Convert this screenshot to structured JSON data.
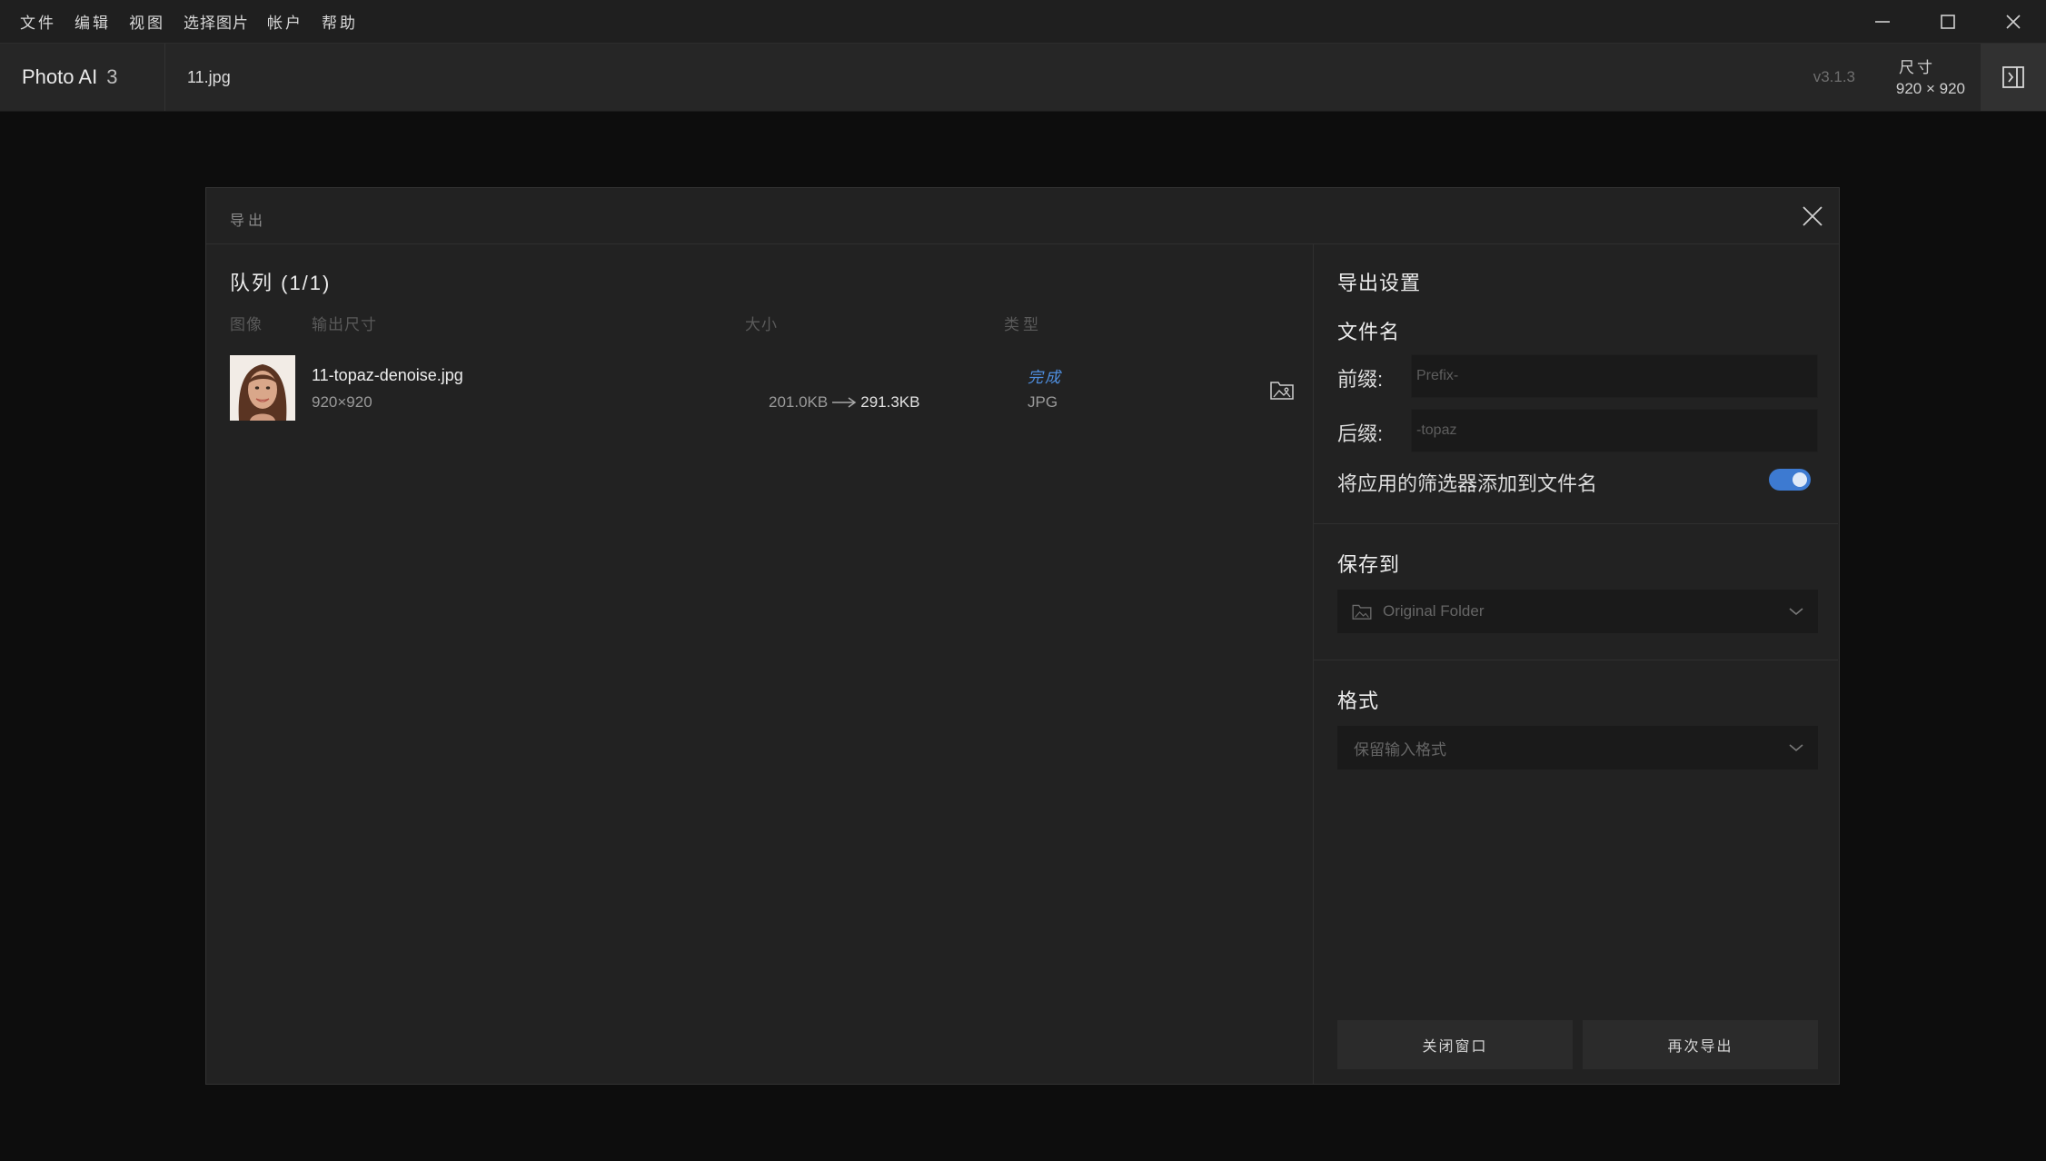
{
  "menubar": {
    "items": [
      "文件",
      "编辑",
      "视图",
      "选择图片",
      "帐户",
      "帮助"
    ]
  },
  "titlebar": {
    "app_name": "Photo AI",
    "app_version_major": "3",
    "file_name": "11.jpg",
    "version": "v3.1.3",
    "dimensions_label": "尺寸",
    "dimensions_value": "920 × 920"
  },
  "dialog": {
    "title": "导出",
    "queue": {
      "title": "队列 (1/1)",
      "columns": {
        "image": "图像",
        "output_size": "输出尺寸",
        "size": "大小",
        "type": "类型"
      },
      "rows": [
        {
          "file_name": "11-topaz-denoise.jpg",
          "dims": "920×920",
          "size_from": "201.0KB",
          "size_to": "291.3KB",
          "status": "完成",
          "type": "JPG"
        }
      ]
    },
    "settings": {
      "title": "导出设置",
      "filename_heading": "文件名",
      "prefix_label": "前缀:",
      "prefix_placeholder": "Prefix-",
      "suffix_label": "后缀:",
      "suffix_value": "-topaz",
      "add_filters_label": "将应用的筛选器添加到文件名",
      "add_filters_on": true,
      "save_to_heading": "保存到",
      "save_to_value": "Original Folder",
      "format_heading": "格式",
      "format_value": "保留输入格式",
      "close_button": "关闭窗口",
      "export_again_button": "再次导出"
    }
  },
  "colors": {
    "accent": "#3d7ad1",
    "status_done": "#4f8fe0",
    "background": "#0d0d0d",
    "dialog_bg": "#222222"
  }
}
